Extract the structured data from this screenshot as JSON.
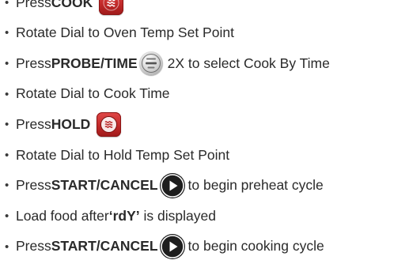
{
  "bullet": "•",
  "steps": [
    {
      "a": "Press ",
      "b": "COOK",
      "c": ""
    },
    {
      "a": "Rotate Dial to Oven Temp Set Point"
    },
    {
      "a": "Press ",
      "b": "PROBE/TIME",
      "c": "2X to select Cook By Time"
    },
    {
      "a": "Rotate Dial to Cook Time"
    },
    {
      "a": "Press ",
      "b": "HOLD",
      "c": ""
    },
    {
      "a": "Rotate Dial to Hold Temp Set Point"
    },
    {
      "a": "Press ",
      "b": "START/CANCEL",
      "c": "to begin preheat cycle"
    },
    {
      "a": "Load food after ",
      "b": "‘rdY’",
      "c": " is displayed"
    },
    {
      "a": "Press ",
      "b": "START/CANCEL",
      "c": "to begin cooking cycle"
    }
  ],
  "icons": {
    "cook": "cook-button-icon",
    "probe": "probe-time-button-icon",
    "hold": "hold-button-icon",
    "start": "start-cancel-play-icon"
  },
  "colors": {
    "button_red": "#c22a2a",
    "play_dark": "#1e1e1e",
    "text": "#2a2a2a"
  }
}
